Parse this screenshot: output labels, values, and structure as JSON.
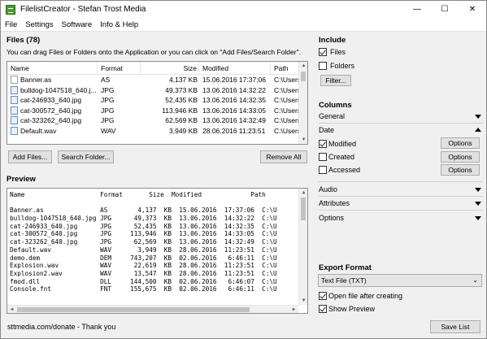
{
  "window": {
    "title": "FilelistCreator - Stefan Trost Media",
    "minimize": "—",
    "maximize": "☐",
    "close": "✕"
  },
  "menu": [
    "File",
    "Settings",
    "Software",
    "Info & Help"
  ],
  "files": {
    "heading": "Files (78)",
    "hint": "You can drag Files or Folders onto the Application or you can click on \"Add Files/Search Folder\".",
    "columns": [
      "Name",
      "Format",
      "Size",
      "Modified",
      "Path"
    ],
    "rows": [
      [
        "Banner.as",
        "AS",
        "4,137 KB",
        "15.06.2016 17:37:06",
        "C:\\Users"
      ],
      [
        "bulldog-1047518_640.j...",
        "JPG",
        "49,373 KB",
        "13.06.2016 14:32:22",
        "C:\\Users"
      ],
      [
        "cat-246933_640.jpg",
        "JPG",
        "52,435 KB",
        "13.06.2016 14:32:35",
        "C:\\Users"
      ],
      [
        "cat-300572_640.jpg",
        "JPG",
        "113,946 KB",
        "13.06.2016 14:33:05",
        "C:\\Users"
      ],
      [
        "cat-323262_640.jpg",
        "JPG",
        "62,569 KB",
        "13.06.2016 14:32:49",
        "C:\\Users"
      ],
      [
        "Default.wav",
        "WAV",
        "3,949 KB",
        "28.06.2016 11:23:51",
        "C:\\Users"
      ]
    ],
    "buttons": {
      "add": "Add Files...",
      "search": "Search Folder...",
      "remove": "Remove All"
    }
  },
  "preview": {
    "heading": "Preview",
    "header_line": "Name                    Format       Size  Modified             Path",
    "lines": [
      "Banner.as               AS        4,137  KB  15.06.2016  17:37:06  C:\\U",
      "bulldog-1047518_640.jpg JPG      49,373  KB  13.06.2016  14:32:22  C:\\U",
      "cat-246933_640.jpg      JPG      52,435  KB  13.06.2016  14:32:35  C:\\U",
      "cat-300572_640.jpg      JPG     113,946  KB  13.06.2016  14:33:05  C:\\U",
      "cat-323262_640.jpg      JPG      62,569  KB  13.06.2016  14:32:49  C:\\U",
      "Default.wav             WAV       3,949  KB  28.06.2016  11:23:51  C:\\U",
      "demo.dem                DEM     743,207  KB  02.06.2016   6:46:11  C:\\U",
      "Explosion.wav           WAV      22,619  KB  28.06.2016  11:23:51  C:\\U",
      "Explosion2.wav          WAV      13,547  KB  28.06.2016  11:23:51  C:\\U",
      "fmod.dll                DLL     144,500  KB  02.06.2016   6:46:07  C:\\U",
      "Console.fnt             FNT     155,675  KB  02.06.2016   6:46:11  C:\\U"
    ]
  },
  "include": {
    "heading": "Include",
    "files_label": "Files",
    "folders_label": "Folders",
    "filter_button": "Filter..."
  },
  "columns_panel": {
    "heading": "Columns",
    "general": "General",
    "date": "Date",
    "modified": "Modified",
    "created": "Created",
    "accessed": "Accessed",
    "options": "Options",
    "audio": "Audio",
    "attributes": "Attributes",
    "options_section": "Options"
  },
  "export": {
    "heading": "Export Format",
    "format": "Text File (TXT)",
    "open_after": "Open file after creating",
    "show_preview": "Show Preview",
    "save_button": "Save List"
  },
  "status": "sttmedia.com/donate - Thank you"
}
